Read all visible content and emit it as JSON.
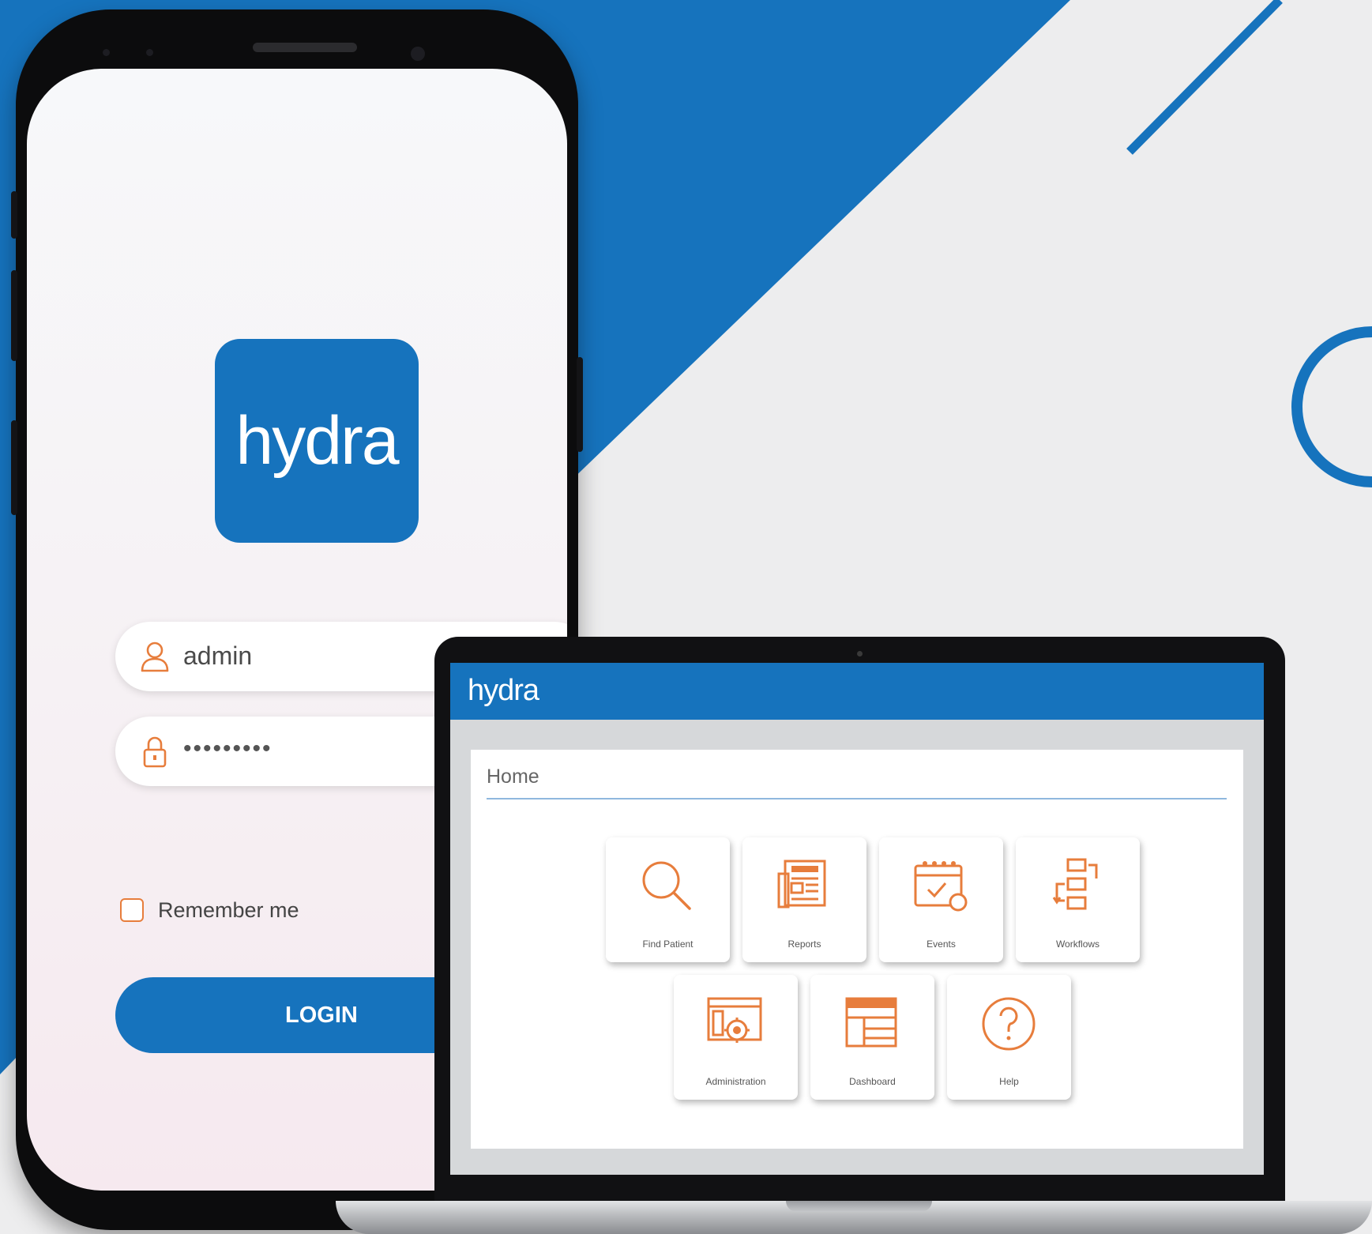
{
  "mobile_login": {
    "logo_text": "hydra",
    "username": {
      "value": "admin",
      "icon": "user-icon"
    },
    "password": {
      "value": "•••••••••",
      "icon": "lock-icon"
    },
    "remember_me_label": "Remember me",
    "remember_me_checked": false,
    "login_label": "LOGIN"
  },
  "desktop_app": {
    "header_title": "hydra",
    "page_title": "Home",
    "tiles": [
      {
        "label": "Find Patient",
        "icon": "search-icon"
      },
      {
        "label": "Reports",
        "icon": "reports-icon"
      },
      {
        "label": "Events",
        "icon": "calendar-icon"
      },
      {
        "label": "Workflows",
        "icon": "workflow-icon"
      },
      {
        "label": "Administration",
        "icon": "admin-settings-icon"
      },
      {
        "label": "Dashboard",
        "icon": "dashboard-icon"
      },
      {
        "label": "Help",
        "icon": "help-icon"
      }
    ]
  },
  "colors": {
    "brand_blue": "#1673bd",
    "accent_orange": "#e77d3c",
    "background": "#ededee"
  }
}
